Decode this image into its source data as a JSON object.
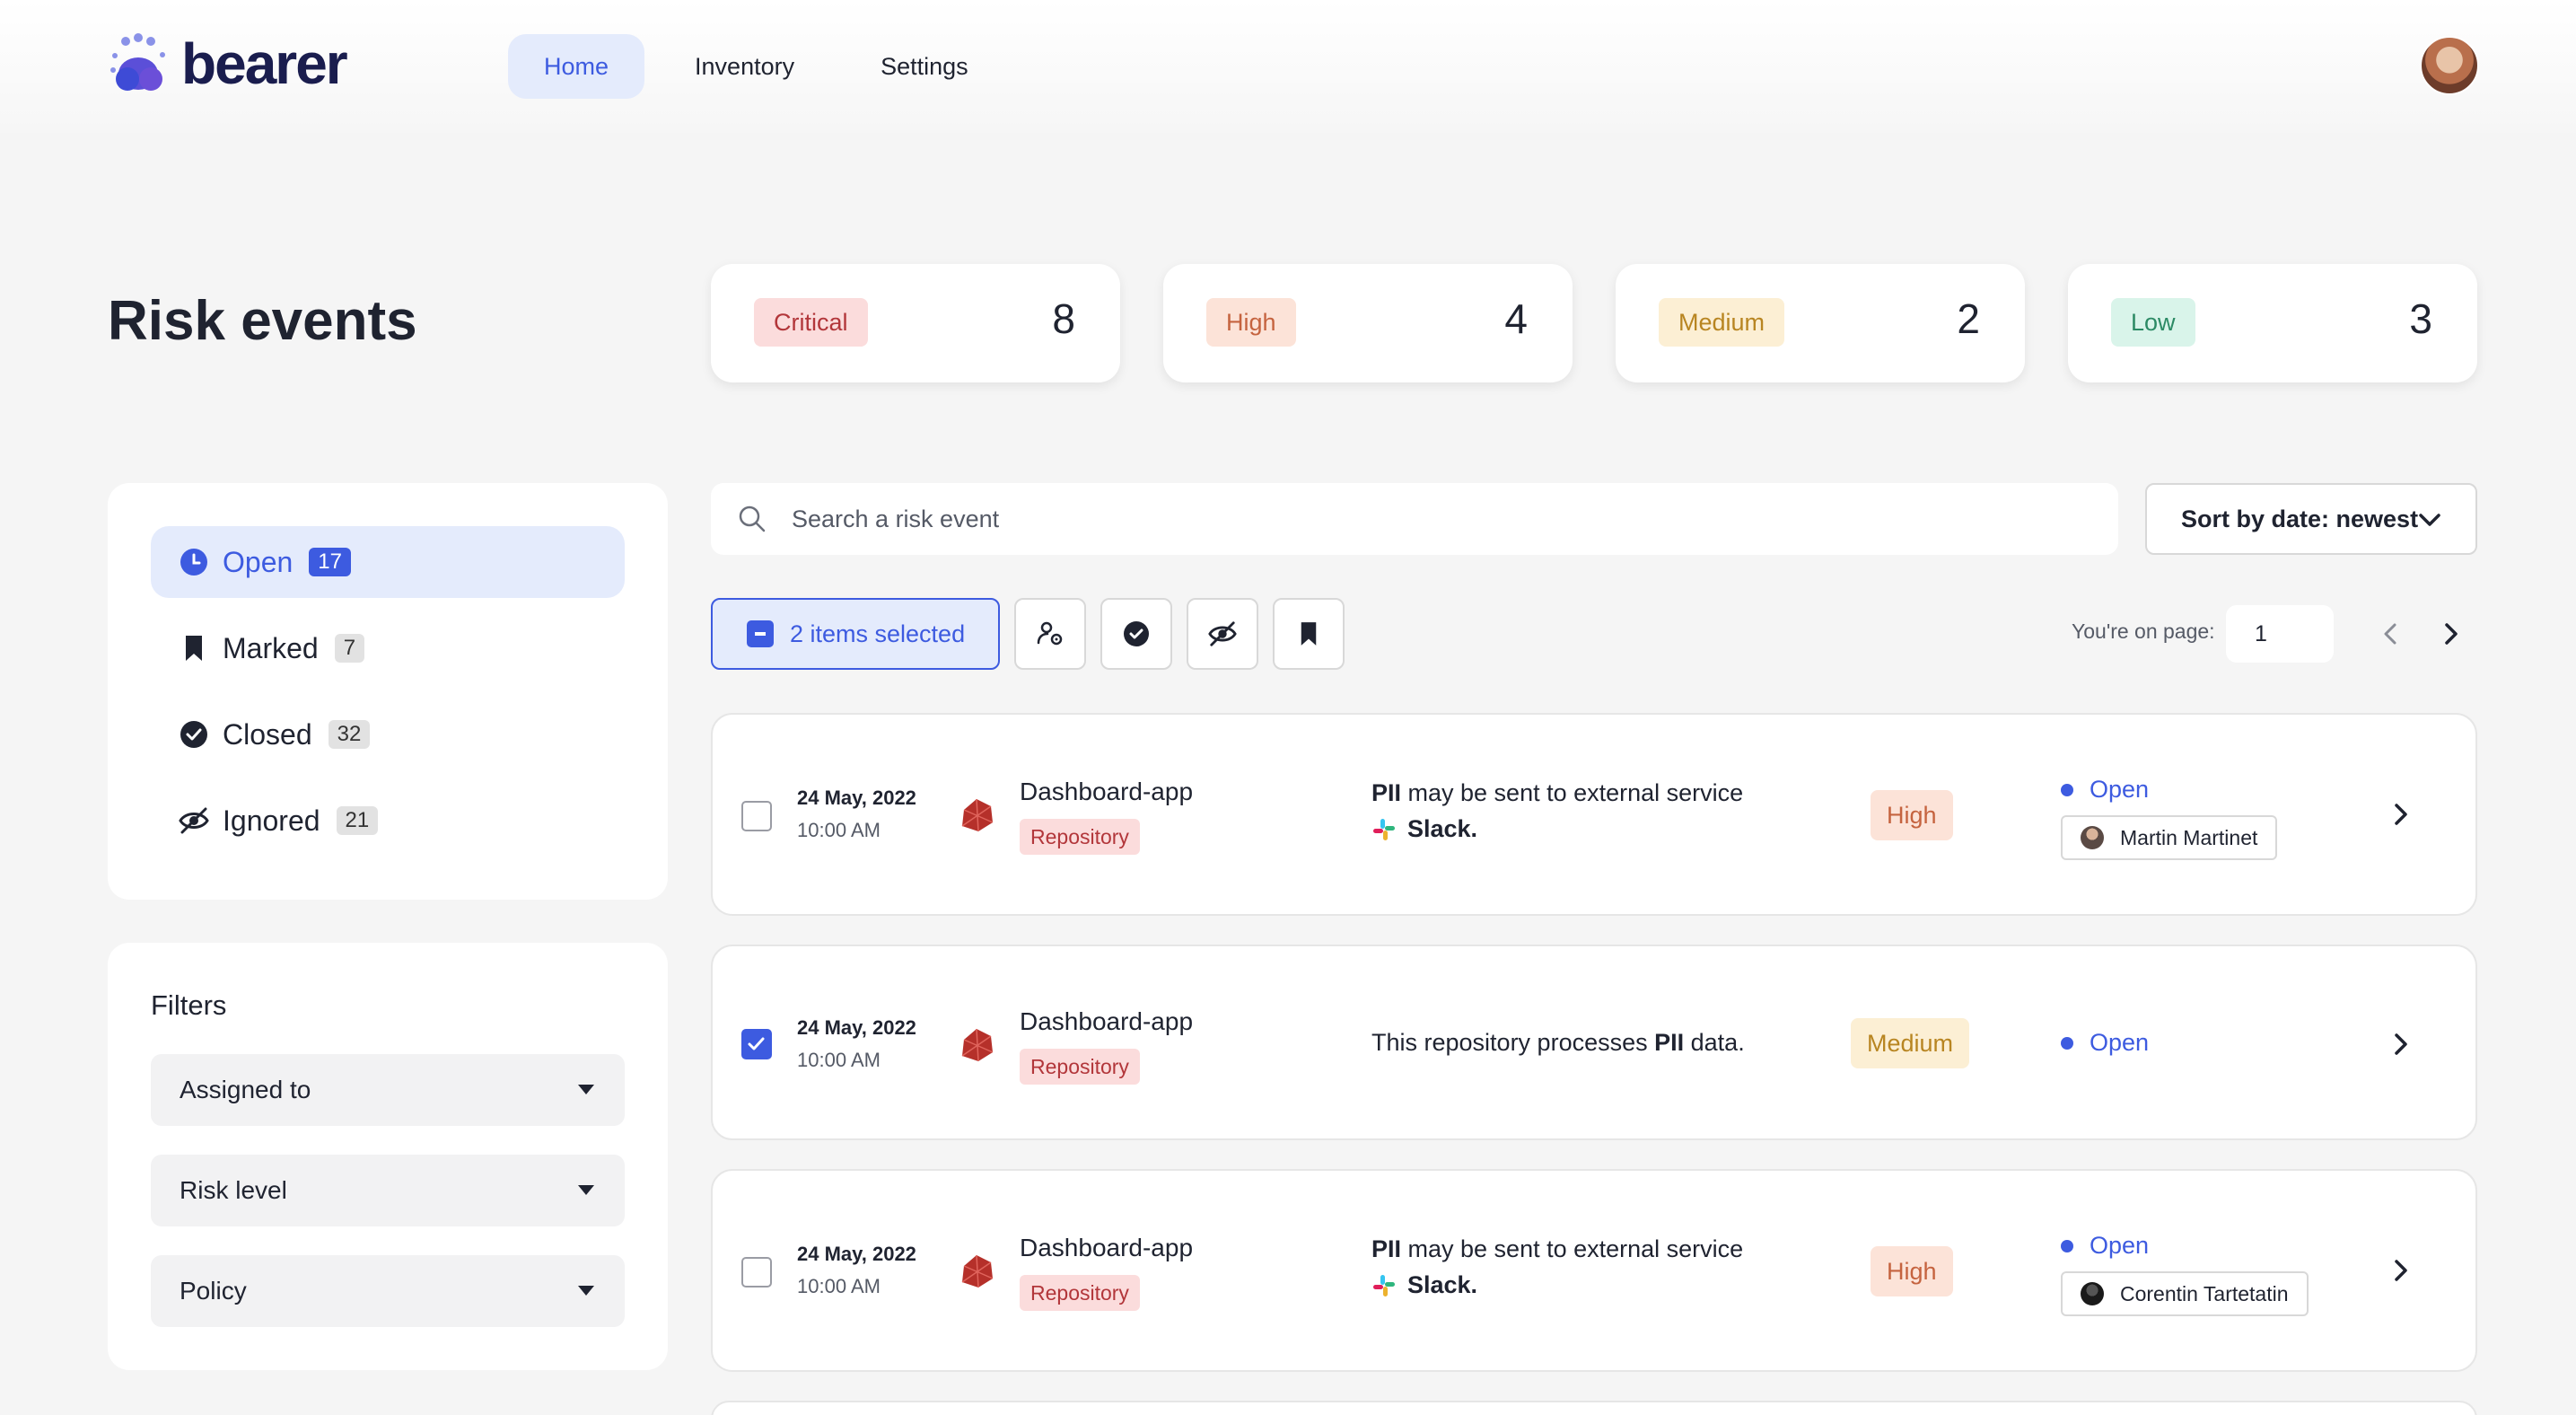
{
  "app": {
    "logo_text": "bearer"
  },
  "nav": [
    {
      "label": "Home",
      "active": true
    },
    {
      "label": "Inventory",
      "active": false
    },
    {
      "label": "Settings",
      "active": false
    }
  ],
  "page": {
    "title": "Risk events"
  },
  "summary": [
    {
      "label": "Critical",
      "count": "8"
    },
    {
      "label": "High",
      "count": "4"
    },
    {
      "label": "Medium",
      "count": "2"
    },
    {
      "label": "Low",
      "count": "3"
    }
  ],
  "statuses": [
    {
      "label": "Open",
      "count": "17",
      "icon": "clock-icon",
      "active": true
    },
    {
      "label": "Marked",
      "count": "7",
      "icon": "bookmark-icon",
      "active": false
    },
    {
      "label": "Closed",
      "count": "32",
      "icon": "check-circle-icon",
      "active": false
    },
    {
      "label": "Ignored",
      "count": "21",
      "icon": "eye-off-icon",
      "active": false
    }
  ],
  "filters": {
    "title": "Filters",
    "dropdowns": [
      {
        "label": "Assigned to"
      },
      {
        "label": "Risk level"
      },
      {
        "label": "Policy"
      }
    ]
  },
  "search": {
    "placeholder": "Search a risk event",
    "value": ""
  },
  "sort": {
    "label": "Sort by date: newest"
  },
  "toolbar": {
    "selected_label": "2 items selected",
    "actions": [
      "assign-user-icon",
      "check-circle-icon",
      "eye-off-icon",
      "bookmark-icon"
    ]
  },
  "pagination": {
    "label": "You're on page:",
    "page": "1"
  },
  "rows": [
    {
      "checked": false,
      "date": "24 May, 2022",
      "time": "10:00 AM",
      "repo_name": "Dashboard-app",
      "repo_type": "Repository",
      "desc_bold": "PII",
      "desc_rest": " may be sent to external service",
      "service": "Slack.",
      "level": "High",
      "status": "Open",
      "assignee": "Martin Martinet"
    },
    {
      "checked": true,
      "date": "24 May, 2022",
      "time": "10:00 AM",
      "repo_name": "Dashboard-app",
      "repo_type": "Repository",
      "desc_pre": "This repository processes ",
      "desc_bold": "PII",
      "desc_post": " data.",
      "level": "Medium",
      "status": "Open"
    },
    {
      "checked": false,
      "date": "24 May, 2022",
      "time": "10:00 AM",
      "repo_name": "Dashboard-app",
      "repo_type": "Repository",
      "desc_bold": "PII",
      "desc_rest": " may be sent to external service",
      "service": "Slack.",
      "level": "High",
      "status": "Open",
      "assignee": "Corentin Tartetatin"
    }
  ],
  "colors": {
    "accent": "#3d5be0",
    "accent_bg": "#e4ebfc",
    "critical": "#b2363a",
    "high": "#c5633f",
    "medium": "#b88521",
    "low": "#2c8a65"
  }
}
